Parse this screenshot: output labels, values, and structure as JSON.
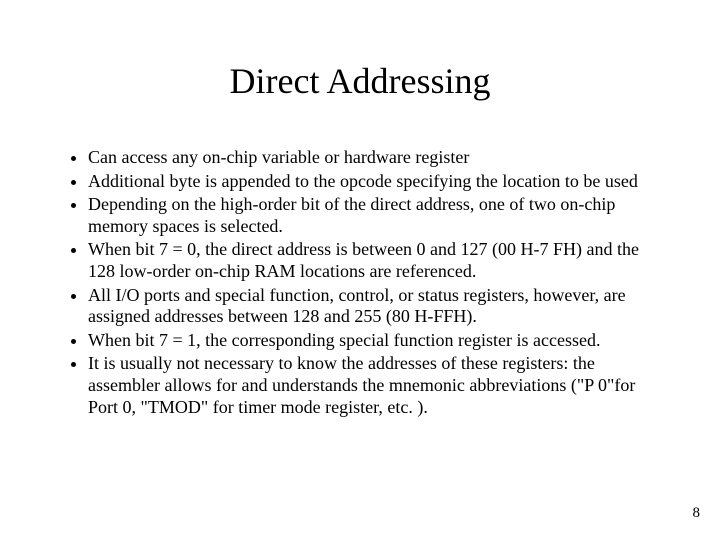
{
  "title": "Direct Addressing",
  "bullets": {
    "b0": "Can access any on-chip variable or hardware register",
    "b1": "Additional byte is appended to the opcode specifying the location to be used",
    "b2": "Depending on the high-order bit of the direct address, one of two on-chip memory spaces is selected.",
    "b3": "When bit 7 = 0, the direct address is between 0 and 127 (00 H-7 FH) and the 128 low-order on-chip RAM locations are referenced.",
    "b4": "All I/O ports and special function, control, or status registers, however, are assigned addresses between 128 and 255 (80 H-FFH).",
    "b5": "When bit 7 = 1, the corresponding special function register is accessed.",
    "b6": "It is usually not necessary to know the addresses of these registers: the assembler allows for and understands the mnemonic abbreviations (\"P 0\"for Port 0, \"TMOD\" for timer mode register, etc. )."
  },
  "page_number": "8"
}
